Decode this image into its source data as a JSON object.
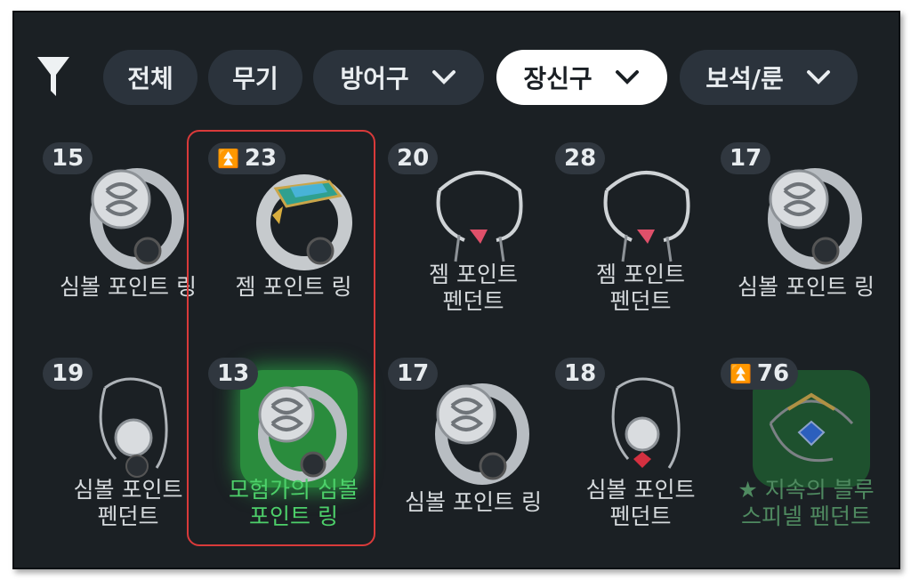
{
  "filters": {
    "all_label": "전체",
    "weapon_label": "무기",
    "armor_label": "방어구",
    "accessory_label": "장신구",
    "gem_label": "보석/룬"
  },
  "items": [
    {
      "level": "15",
      "name_line1": "심볼 포인트 링",
      "name_line2": ""
    },
    {
      "level": "23",
      "name_line1": "젬 포인트 링",
      "name_line2": ""
    },
    {
      "level": "20",
      "name_line1": "젬 포인트",
      "name_line2": "펜던트"
    },
    {
      "level": "28",
      "name_line1": "젬 포인트",
      "name_line2": "펜던트"
    },
    {
      "level": "17",
      "name_line1": "심볼 포인트 링",
      "name_line2": ""
    },
    {
      "level": "19",
      "name_line1": "심볼 포인트",
      "name_line2": "펜던트"
    },
    {
      "level": "13",
      "name_line1": "모험가의 심볼",
      "name_line2": "포인트 링"
    },
    {
      "level": "17",
      "name_line1": "심볼 포인트 링",
      "name_line2": ""
    },
    {
      "level": "18",
      "name_line1": "심볼 포인트",
      "name_line2": "펜던트"
    },
    {
      "level": "76",
      "name_line1": "★ 지속의 블루",
      "name_line2": "스피넬 펜던트"
    }
  ],
  "colors": {
    "background": "#1b2024",
    "chip": "#2b333c",
    "chip_active": "#ffffff",
    "selection_outline": "#d93a3a",
    "highlight_green": "#4dd06a",
    "upgrade_arrow": "#3ed46b"
  },
  "icons": [
    "filter-icon",
    "chevron-down-icon",
    "upgrade-arrow-icon",
    "ring-icon",
    "pendant-icon"
  ]
}
